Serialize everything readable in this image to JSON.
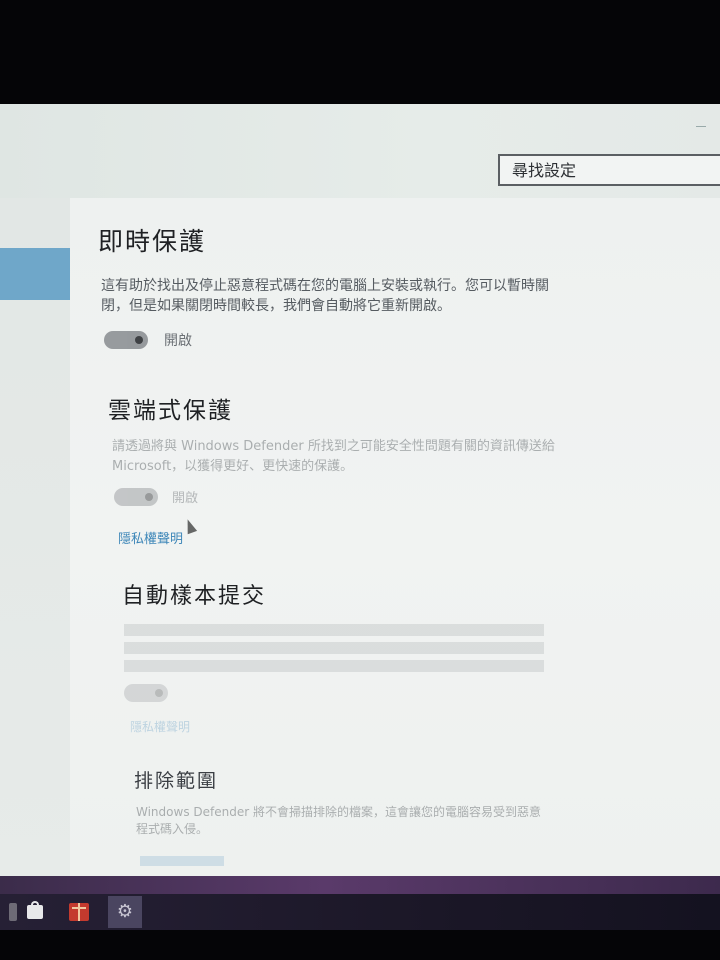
{
  "header": {
    "search_placeholder": "尋找設定"
  },
  "sections": {
    "realtime": {
      "title": "即時保護",
      "description": "這有助於找出及停止惡意程式碼在您的電腦上安裝或執行。您可以暫時關閉，但是如果關閉時間較長，我們會自動將它重新開啟。",
      "toggle_label": "開啟"
    },
    "cloud": {
      "title": "雲端式保護",
      "description": "請透過將與 Windows Defender 所找到之可能安全性問題有關的資訊傳送給 Microsoft，以獲得更好、更快速的保護。",
      "toggle_label": "開啟",
      "link": "隱私權聲明"
    },
    "sample": {
      "title": "自動樣本提交",
      "link": "隱私權聲明"
    },
    "exclusions": {
      "title": "排除範圍",
      "description": "Windows Defender 將不會掃描排除的檔案，這會讓您的電腦容易受到惡意程式碼入侵。"
    }
  },
  "taskbar": {
    "icons": [
      "edge-icon",
      "store-icon",
      "gift-icon",
      "gear-icon"
    ]
  },
  "colors": {
    "accent": "#6fa7c9",
    "link": "#3d86b8",
    "taskbar": "#1b1727"
  }
}
